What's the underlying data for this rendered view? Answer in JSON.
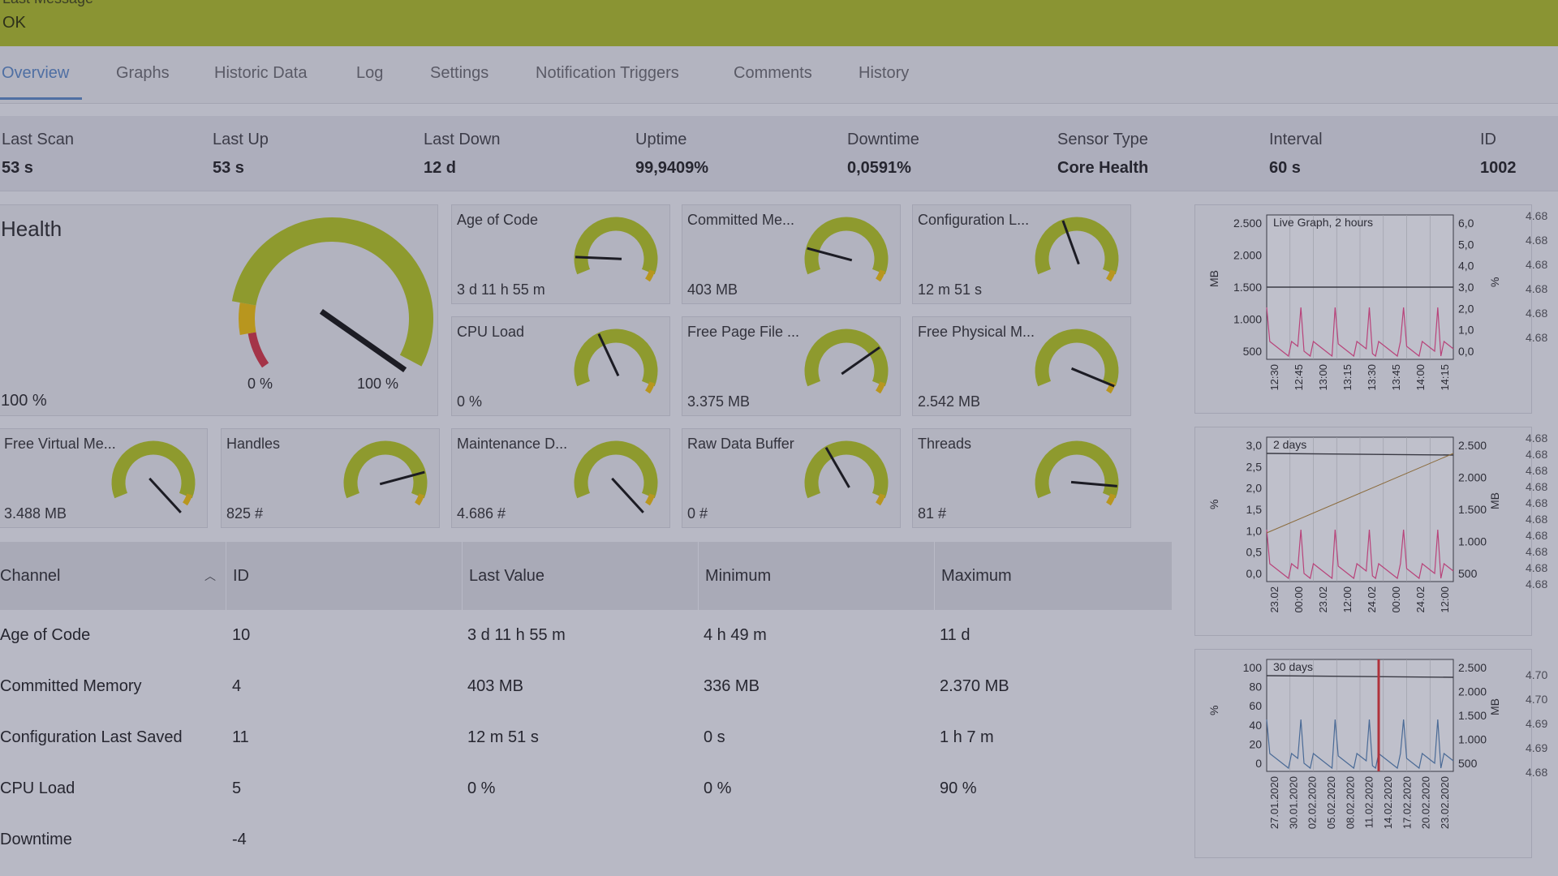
{
  "banner": {
    "title": "Last Message",
    "message": "OK"
  },
  "tabs": [
    "Overview",
    "Graphs",
    "Historic Data",
    "Log",
    "Settings",
    "Notification Triggers",
    "Comments",
    "History"
  ],
  "stats": [
    {
      "label": "Last Scan",
      "value": "53 s"
    },
    {
      "label": "Last Up",
      "value": "53 s"
    },
    {
      "label": "Last Down",
      "value": "12 d"
    },
    {
      "label": "Uptime",
      "value": "99,9409%"
    },
    {
      "label": "Downtime",
      "value": "0,0591%"
    },
    {
      "label": "Sensor Type",
      "value": "Core Health"
    },
    {
      "label": "Interval",
      "value": "60 s"
    },
    {
      "label": "ID",
      "value": "1002"
    }
  ],
  "health": {
    "title": "Health",
    "value": "100 %",
    "min_label": "0 %",
    "max_label": "100 %",
    "level": 1.0
  },
  "gauges": [
    {
      "title": "Age of Code",
      "value": "3 d 11 h 55 m",
      "level": 0.15
    },
    {
      "title": "Committed Me...",
      "value": "403 MB",
      "level": 0.2
    },
    {
      "title": "Configuration L...",
      "value": "12 m 51 s",
      "level": 0.42
    },
    {
      "title": "CPU Load",
      "value": "0 %",
      "level": 0.4
    },
    {
      "title": "Free Page File ...",
      "value": "3.375 MB",
      "level": 0.72
    },
    {
      "title": "Free Physical M...",
      "value": "2.542 MB",
      "level": 0.95
    },
    {
      "title": "Free Virtual Me...",
      "value": "3.488 MB",
      "level": 1.05
    },
    {
      "title": "Handles",
      "value": "825 #",
      "level": 0.8
    },
    {
      "title": "Maintenance D...",
      "value": "4.686 #",
      "level": 1.05
    },
    {
      "title": "Raw Data Buffer",
      "value": "0 #",
      "level": 0.38
    },
    {
      "title": "Threads",
      "value": "81 #",
      "level": 0.88
    }
  ],
  "table": {
    "columns": [
      "Channel",
      "ID",
      "Last Value",
      "Minimum",
      "Maximum"
    ],
    "rows": [
      [
        "Age of Code",
        "10",
        "3 d 11 h 55 m",
        "4 h 49 m",
        "11 d"
      ],
      [
        "Committed Memory",
        "4",
        "403 MB",
        "336 MB",
        "2.370 MB"
      ],
      [
        "Configuration Last Saved",
        "11",
        "12 m 51 s",
        "0 s",
        "1 h 7 m"
      ],
      [
        "CPU Load",
        "5",
        "0 %",
        "0 %",
        "90 %"
      ],
      [
        "Downtime",
        "-4",
        "",
        "",
        ""
      ]
    ]
  },
  "graphs": [
    {
      "title": "Live Graph, 2 hours",
      "left_axis": "MB",
      "right_axis": "%",
      "left_ticks": [
        "2.500",
        "2.000",
        "1.500",
        "1.000",
        "500"
      ],
      "right_ticks": [
        "6,0",
        "5,0",
        "4,0",
        "3,0",
        "2,0",
        "1,0",
        "0,0"
      ],
      "x_ticks": [
        "12:30",
        "12:45",
        "13:00",
        "13:15",
        "13:30",
        "13:45",
        "14:00",
        "14:15"
      ]
    },
    {
      "title": "2 days",
      "left_axis": "%",
      "right_axis": "MB",
      "left_ticks": [
        "3,0",
        "2,5",
        "2,0",
        "1,5",
        "1,0",
        "0,5",
        "0,0"
      ],
      "right_ticks": [
        "2.500",
        "2.000",
        "1.500",
        "1.000",
        "500"
      ],
      "x_ticks": [
        "23.02",
        "00:00",
        "23.02",
        "12:00",
        "24.02",
        "00:00",
        "24.02",
        "12:00"
      ]
    },
    {
      "title": "30 days",
      "left_axis": "%",
      "right_axis": "MB",
      "left_ticks": [
        "100",
        "80",
        "60",
        "40",
        "20",
        "0"
      ],
      "right_ticks": [
        "2.500",
        "2.000",
        "1.500",
        "1.000",
        "500"
      ],
      "x_ticks": [
        "27.01.2020",
        "30.01.2020",
        "02.02.2020",
        "05.02.2020",
        "08.02.2020",
        "11.02.2020",
        "14.02.2020",
        "17.02.2020",
        "20.02.2020",
        "23.02.2020"
      ]
    }
  ],
  "edge_labels": {
    "g1": [
      "4.68",
      "4.68",
      "4.68",
      "4.68",
      "4.68",
      "4.68"
    ],
    "g2": [
      "4.68",
      "4.68",
      "4.68",
      "4.68",
      "4.68",
      "4.68",
      "4.68",
      "4.68",
      "4.68",
      "4.68"
    ],
    "g3": [
      "4.70",
      "4.70",
      "4.69",
      "4.69",
      "4.68"
    ]
  },
  "colors": {
    "gauge": "#8e9a2e",
    "warn": "#b8961e",
    "error": "#a43448",
    "accent": "#4f6fa3"
  }
}
